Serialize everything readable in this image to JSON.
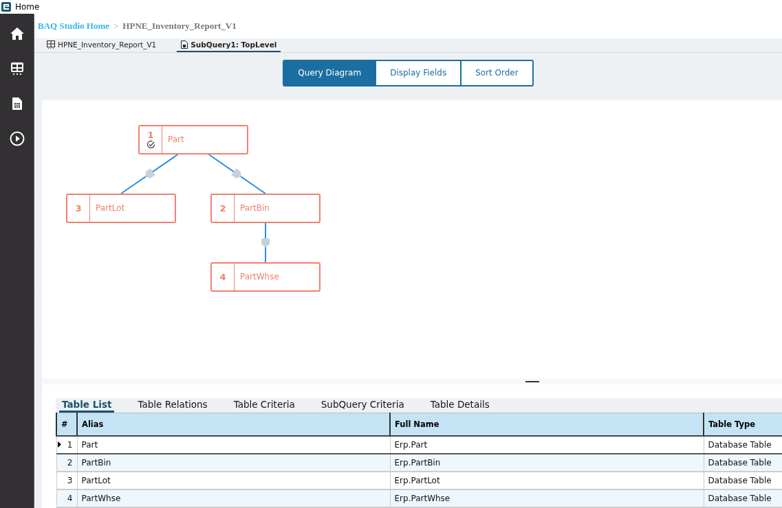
{
  "window": {
    "title": "Home"
  },
  "sidebar": {
    "items": [
      {
        "kind": "home",
        "selected": false
      },
      {
        "kind": "grid",
        "selected": false
      },
      {
        "kind": "report",
        "selected": false
      },
      {
        "kind": "play",
        "selected": false
      }
    ]
  },
  "breadcrumb": {
    "items": [
      "BAQ Studio Home",
      "HPNE_Inventory_Report_V1"
    ],
    "separator": ">"
  },
  "doc_tabs": [
    {
      "label": "HPNE_Inventory_Report_V1",
      "kind": "grid",
      "selected": false
    },
    {
      "label": "SubQuery1: TopLevel",
      "kind": "report",
      "selected": true
    }
  ],
  "view_buttons": [
    {
      "label": "Query Diagram",
      "selected": true
    },
    {
      "label": "Display Fields",
      "selected": false
    },
    {
      "label": "Sort Order",
      "selected": false
    }
  ],
  "diagram": {
    "nodes": [
      {
        "number": "1",
        "label": "Part",
        "primary": true,
        "children": [
          {
            "number": "3",
            "label": "PartLot",
            "primary": false
          },
          {
            "number": "2",
            "label": "PartBin",
            "primary": false,
            "children": [
              {
                "number": "4",
                "label": "PartWhse",
                "primary": false
              }
            ]
          }
        ]
      }
    ]
  },
  "detail_tabs": [
    {
      "label": "Table List",
      "selected": true
    },
    {
      "label": "Table Relations",
      "selected": false
    },
    {
      "label": "Table Criteria",
      "selected": false
    },
    {
      "label": "SubQuery Criteria",
      "selected": false
    },
    {
      "label": "Table Details",
      "selected": false
    }
  ],
  "table": {
    "columns": [
      "#",
      "Alias",
      "Full Name",
      "Table Type"
    ],
    "rows": [
      {
        "cells": [
          "1",
          "Part",
          "Erp.Part",
          "Database Table"
        ],
        "selected": true
      },
      {
        "cells": [
          "2",
          "PartBin",
          "Erp.PartBin",
          "Database Table"
        ],
        "selected": false
      },
      {
        "cells": [
          "3",
          "PartLot",
          "Erp.PartLot",
          "Database Table"
        ],
        "selected": false
      },
      {
        "cells": [
          "4",
          "PartWhse",
          "Erp.PartWhse",
          "Database Table"
        ],
        "selected": false
      }
    ]
  }
}
